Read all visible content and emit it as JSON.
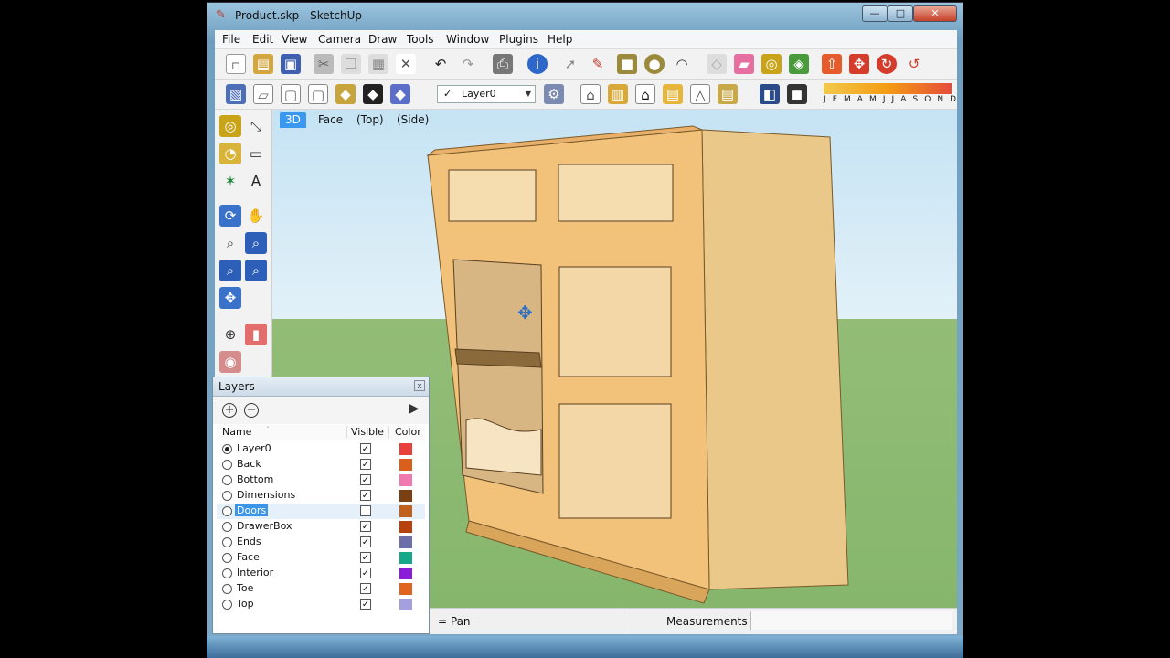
{
  "window": {
    "title": "Product.skp - SketchUp",
    "minimize_glyph": "—",
    "maximize_glyph": "□",
    "close_glyph": "✕"
  },
  "menu": {
    "items": [
      "File",
      "Edit",
      "View",
      "Camera",
      "Draw",
      "Tools",
      "Window",
      "Plugins",
      "Help"
    ]
  },
  "toolbar": {
    "layer_selector": {
      "check": "✓",
      "value": "Layer0",
      "arrow": "▼"
    },
    "months_text": "J F M A M J J A S O N D"
  },
  "scenes": {
    "tabs": [
      "3D",
      "Face",
      "(Top)",
      "(Side)"
    ],
    "active_index": 0
  },
  "status": {
    "hint": "= Pan",
    "measurements_label": "Measurements"
  },
  "layers_panel": {
    "title": "Layers",
    "close_glyph": "x",
    "add_glyph": "+",
    "remove_glyph": "−",
    "details_glyph": "▶",
    "columns": {
      "name": "Name",
      "sort": "ˇ",
      "visible": "Visible",
      "color": "Color"
    },
    "layers": [
      {
        "name": "Layer0",
        "active": true,
        "visible": true,
        "selected": false,
        "color": "#e8413c"
      },
      {
        "name": "Back",
        "active": false,
        "visible": true,
        "selected": false,
        "color": "#d9601c"
      },
      {
        "name": "Bottom",
        "active": false,
        "visible": true,
        "selected": false,
        "color": "#f07ab0"
      },
      {
        "name": "Dimensions",
        "active": false,
        "visible": true,
        "selected": false,
        "color": "#7a3f12"
      },
      {
        "name": "Doors",
        "active": false,
        "visible": false,
        "selected": true,
        "color": "#c0601c"
      },
      {
        "name": "DrawerBox",
        "active": false,
        "visible": true,
        "selected": false,
        "color": "#b8420e"
      },
      {
        "name": "Ends",
        "active": false,
        "visible": true,
        "selected": false,
        "color": "#6d6fa8"
      },
      {
        "name": "Face",
        "active": false,
        "visible": true,
        "selected": false,
        "color": "#17a889"
      },
      {
        "name": "Interior",
        "active": false,
        "visible": true,
        "selected": false,
        "color": "#8a1ed8"
      },
      {
        "name": "Toe",
        "active": false,
        "visible": true,
        "selected": false,
        "color": "#e0641e"
      },
      {
        "name": "Top",
        "active": false,
        "visible": true,
        "selected": false,
        "color": "#a4a0e0"
      }
    ]
  },
  "colors": {
    "scene_active": "#3a98f0",
    "selection": "#3b95e8"
  }
}
